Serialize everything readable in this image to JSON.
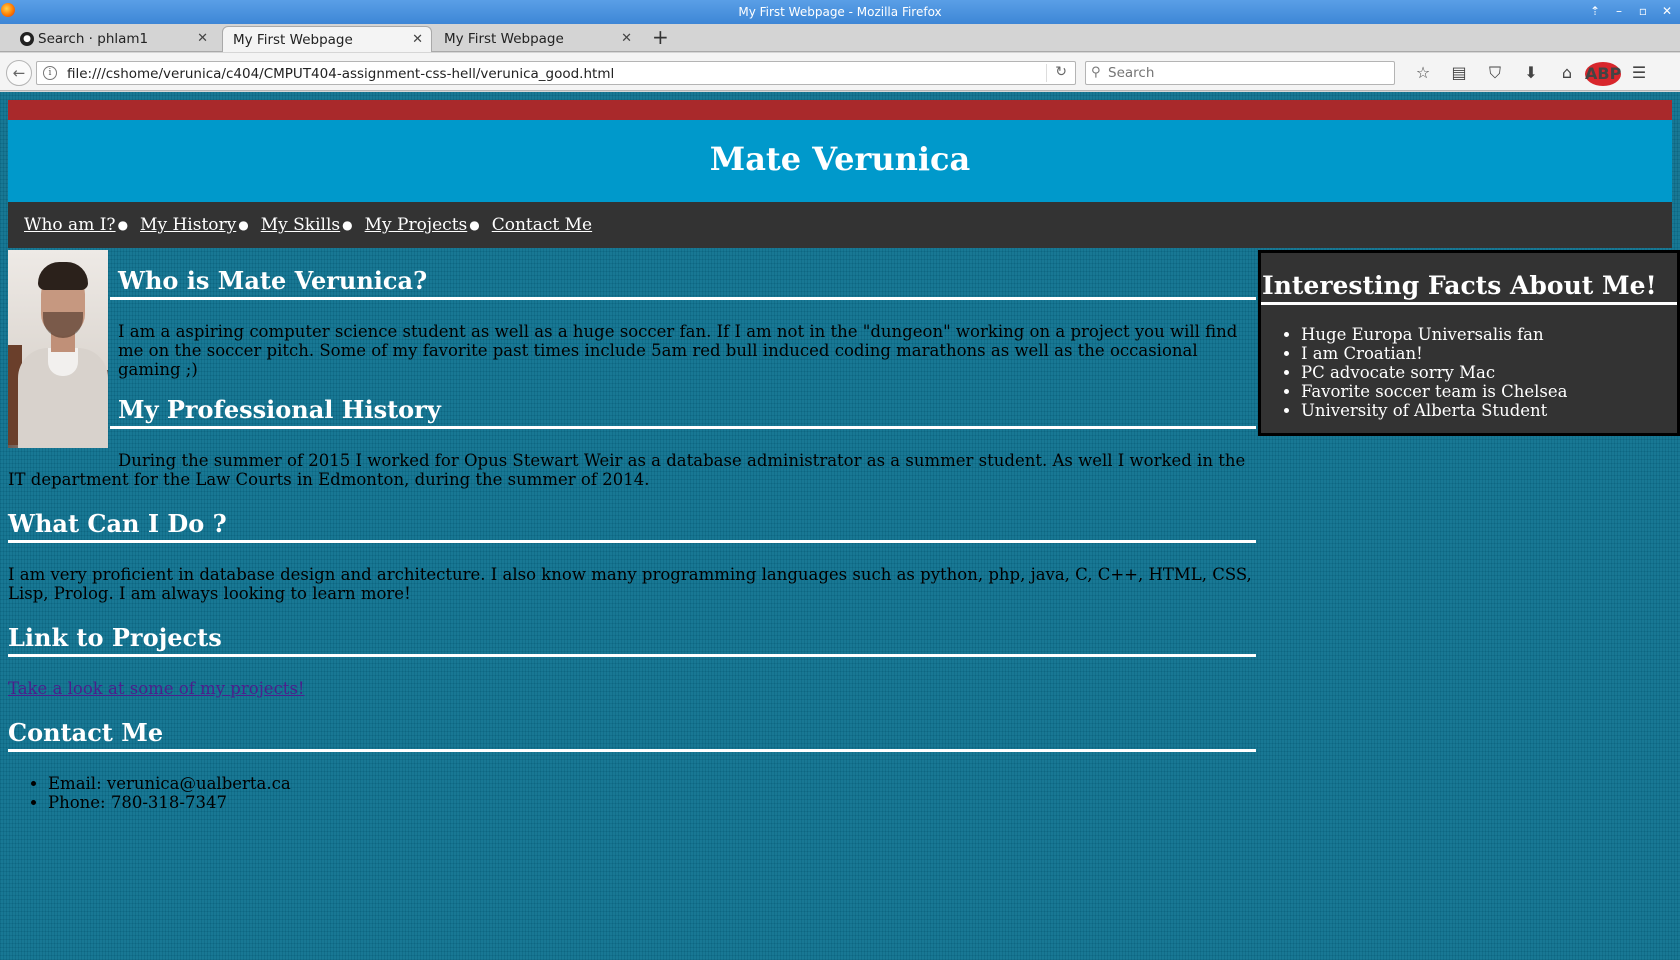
{
  "window": {
    "title": "My First Webpage - Mozilla Firefox"
  },
  "tabs": [
    {
      "label": "Search · phlam1",
      "icon": "github-icon"
    },
    {
      "label": "My First Webpage",
      "icon": "none"
    },
    {
      "label": "My First Webpage",
      "icon": "none"
    }
  ],
  "navbar": {
    "url": "file:///cshome/verunica/c404/CMPUT404-assignment-css-hell/verunica_good.html",
    "search_placeholder": "Search",
    "abp_label": "ABP"
  },
  "page": {
    "site_title": "Mate Verunica",
    "menu": [
      "Who am I?",
      "My History",
      "My Skills",
      "My Projects",
      "Contact Me"
    ],
    "who_heading": "Who is Mate Verunica?",
    "who_text": "I am a aspiring computer science student as well as a huge soccer fan. If I am not in the \"dungeon\" working on a project you will find me on the soccer pitch. Some of my favorite past times include 5am red bull induced coding marathons as well as the occasional gaming ;)",
    "history_heading": "My Professional History",
    "history_text": "During the summer of 2015 I worked for Opus Stewart Weir as a database administrator as a summer student. As well I worked in the IT department for the Law Courts in Edmonton, during the summer of 2014.",
    "skills_heading": "What Can I Do ?",
    "skills_text": "I am very proficient in database design and architecture. I also know many programming languages such as python, php, java, C, C++, HTML, CSS, Lisp, Prolog. I am always looking to learn more!",
    "projects_heading": "Link to Projects",
    "projects_link": "Take a look at some of my projects!",
    "contact_heading": "Contact Me",
    "contact_items": [
      "Email: verunica@ualberta.ca",
      "Phone: 780-318-7347"
    ],
    "facts_heading": "Interesting Facts About Me!",
    "facts": [
      "Huge Europa Universalis fan",
      "I am Croatian!",
      "PC advocate sorry Mac",
      "Favorite soccer team is Chelsea",
      "University of Alberta Student"
    ]
  },
  "colors": {
    "red_bar": "#a9292b",
    "header_bg": "#0099cb",
    "menu_bg": "#333333",
    "page_bg": "#0f7290",
    "link_visited": "#4b1f8c"
  }
}
